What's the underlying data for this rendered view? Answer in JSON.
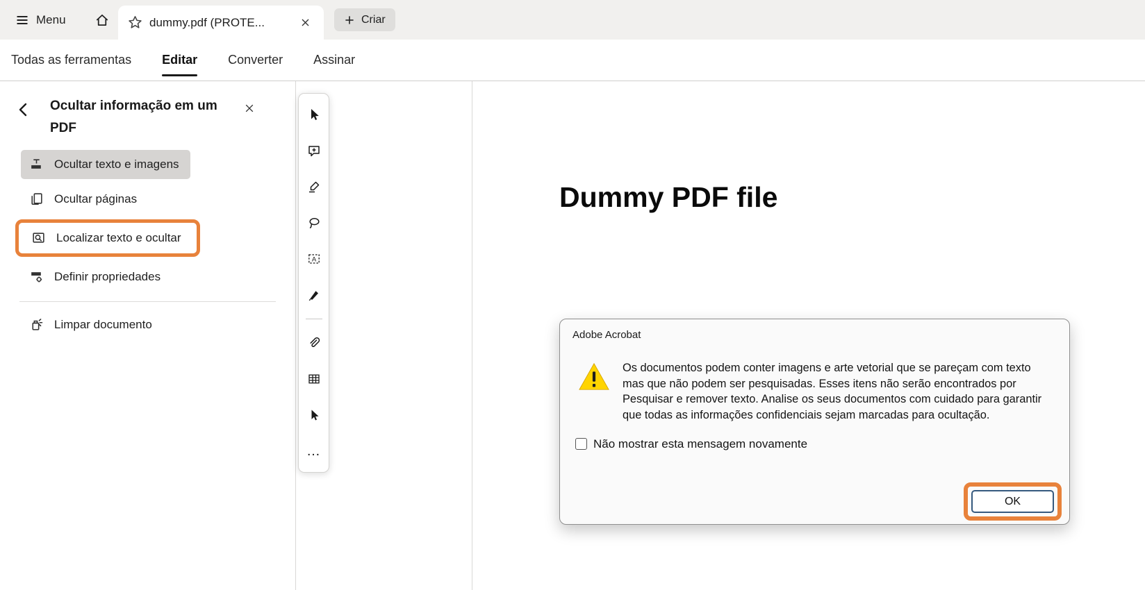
{
  "tab_bar": {
    "menu_label": "Menu",
    "tab_title": "dummy.pdf (PROTE...",
    "create_label": "Criar"
  },
  "nav": {
    "items": [
      {
        "label": "Todas as ferramentas"
      },
      {
        "label": "Editar"
      },
      {
        "label": "Converter"
      },
      {
        "label": "Assinar"
      }
    ]
  },
  "left_panel": {
    "title": "Ocultar informação em um PDF",
    "items": [
      {
        "label": "Ocultar texto e imagens"
      },
      {
        "label": "Ocultar páginas"
      },
      {
        "label": "Localizar texto e ocultar"
      },
      {
        "label": "Definir propriedades"
      },
      {
        "label": "Limpar documento"
      }
    ]
  },
  "document": {
    "title": "Dummy PDF file"
  },
  "dialog": {
    "title": "Adobe Acrobat",
    "message": "Os documentos podem conter imagens e arte vetorial que se pareçam com texto mas que não podem ser pesquisadas. Esses itens não serão encontrados por Pesquisar e remover texto. Analise os seus documentos com cuidado para garantir que todas as informações confidenciais sejam marcadas para ocultação.",
    "checkbox_label": "Não mostrar esta mensagem novamente",
    "ok_label": "OK"
  },
  "colors": {
    "annotation_orange": "#E8823B",
    "selected_item_bg": "#D6D4D2",
    "warning_yellow": "#FFD400"
  }
}
